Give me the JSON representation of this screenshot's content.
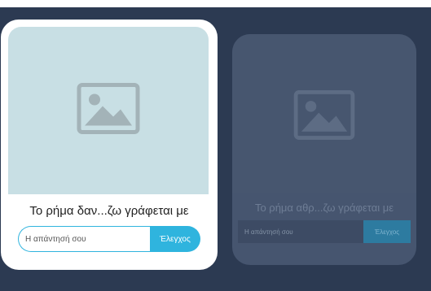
{
  "cards": [
    {
      "prompt": "Το ρήμα δαν...ζω γράφεται με",
      "input_placeholder": "Η απάντησή σου",
      "input_value": "",
      "check_label": "Έλεγχος",
      "image_icon": "image-placeholder-icon"
    },
    {
      "prompt": "Το ρήμα αθρ...ζω γράφεται με",
      "input_placeholder": "Η απάντησή σου",
      "input_value": "",
      "check_label": "Έλεγχος",
      "image_icon": "image-placeholder-icon"
    }
  ],
  "colors": {
    "background": "#2c3a52",
    "card_active": "#ffffff",
    "image_area": "#c8dfe4",
    "accent": "#2fb4de",
    "card_inactive": "#46556f"
  }
}
